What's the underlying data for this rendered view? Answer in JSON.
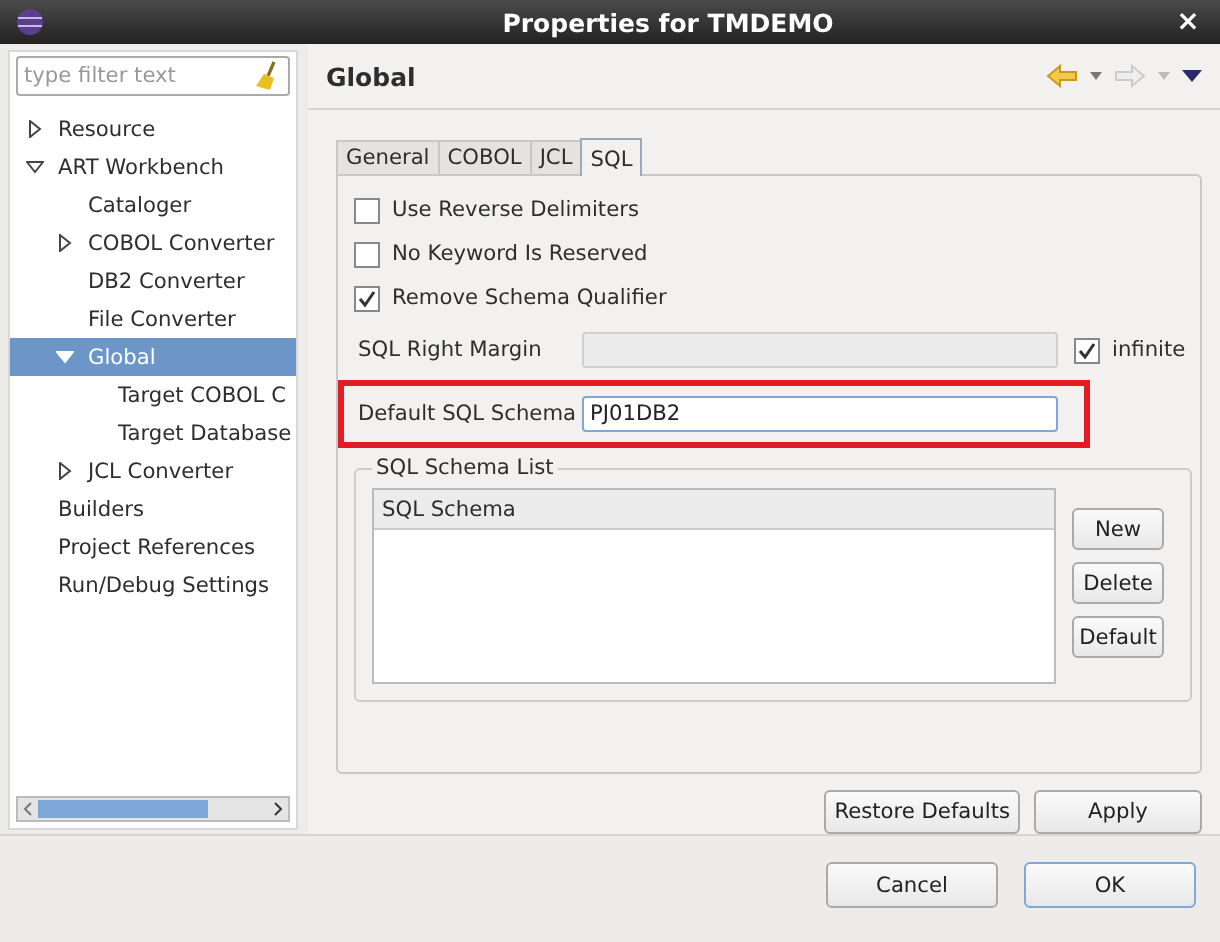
{
  "window": {
    "title": "Properties for TMDEMO",
    "close": "×"
  },
  "filter": {
    "placeholder": "type filter text"
  },
  "tree": [
    {
      "label": "Resource",
      "expanded": false,
      "selected": false
    },
    {
      "label": "ART Workbench",
      "expanded": true,
      "selected": false,
      "children": [
        {
          "label": "Cataloger",
          "selected": false
        },
        {
          "label": "COBOL Converter",
          "expanded": false,
          "selected": false
        },
        {
          "label": "DB2 Converter",
          "selected": false
        },
        {
          "label": "File Converter",
          "selected": false
        },
        {
          "label": "Global",
          "expanded": true,
          "selected": true,
          "children": [
            {
              "label": "Target COBOL C",
              "selected": false
            },
            {
              "label": "Target Database",
              "selected": false
            }
          ]
        },
        {
          "label": "JCL Converter",
          "expanded": false,
          "selected": false
        }
      ]
    },
    {
      "label": "Builders",
      "selected": false
    },
    {
      "label": "Project References",
      "selected": false
    },
    {
      "label": "Run/Debug Settings",
      "selected": false
    }
  ],
  "page": {
    "title": "Global"
  },
  "tabs": [
    {
      "label": "General",
      "selected": false
    },
    {
      "label": "COBOL",
      "selected": false
    },
    {
      "label": "JCL",
      "selected": false
    },
    {
      "label": "SQL",
      "selected": true
    }
  ],
  "options": [
    {
      "label": "Use Reverse Delimiters",
      "checked": false
    },
    {
      "label": "No Keyword Is Reserved",
      "checked": false
    },
    {
      "label": "Remove Schema Qualifier",
      "checked": true
    }
  ],
  "right_margin": {
    "label": "SQL Right Margin",
    "disabled": true,
    "infinite": {
      "label": "infinite",
      "checked": true
    }
  },
  "default_schema": {
    "label": "Default SQL Schema",
    "value": "PJ01DB2",
    "highlighted": true
  },
  "schema_list": {
    "title": "SQL Schema List",
    "columns": [
      "SQL Schema"
    ],
    "buttons": [
      "New",
      "Delete",
      "Default"
    ]
  },
  "page_buttons": [
    "Restore Defaults",
    "Apply"
  ],
  "dialog_buttons": [
    {
      "label": "Cancel",
      "default": false
    },
    {
      "label": "OK",
      "default": true
    }
  ]
}
